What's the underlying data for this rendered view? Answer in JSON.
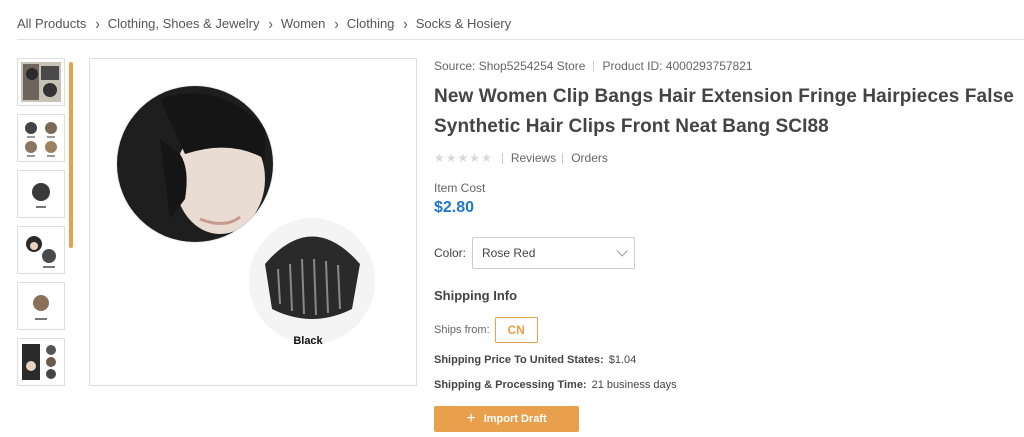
{
  "breadcrumb": [
    "All Products",
    "Clothing, Shoes & Jewelry",
    "Women",
    "Clothing",
    "Socks & Hosiery"
  ],
  "product": {
    "source": "Source: Shop5254254 Store",
    "product_id": "Product ID: 4000293757821",
    "title": "New Women Clip Bangs Hair Extension Fringe Hairpieces False Synthetic Hair Clips Front Neat Bang SCI88",
    "reviews_label": "Reviews",
    "orders_label": "Orders",
    "rating_stars": 0,
    "item_cost_label": "Item Cost",
    "price": "$2.80",
    "image_caption": "Black"
  },
  "color": {
    "label": "Color:",
    "selected": "Rose Red"
  },
  "shipping": {
    "title": "Shipping Info",
    "ships_from_label": "Ships from:",
    "ships_from_value": "CN",
    "price_label": "Shipping Price To United States:",
    "price_value": "$1.04",
    "time_label": "Shipping & Processing Time:",
    "time_value": "21 business days"
  },
  "actions": {
    "import_label": "Import Draft"
  },
  "colors": {
    "accent": "#e8a04c",
    "price": "#1f78c8"
  }
}
